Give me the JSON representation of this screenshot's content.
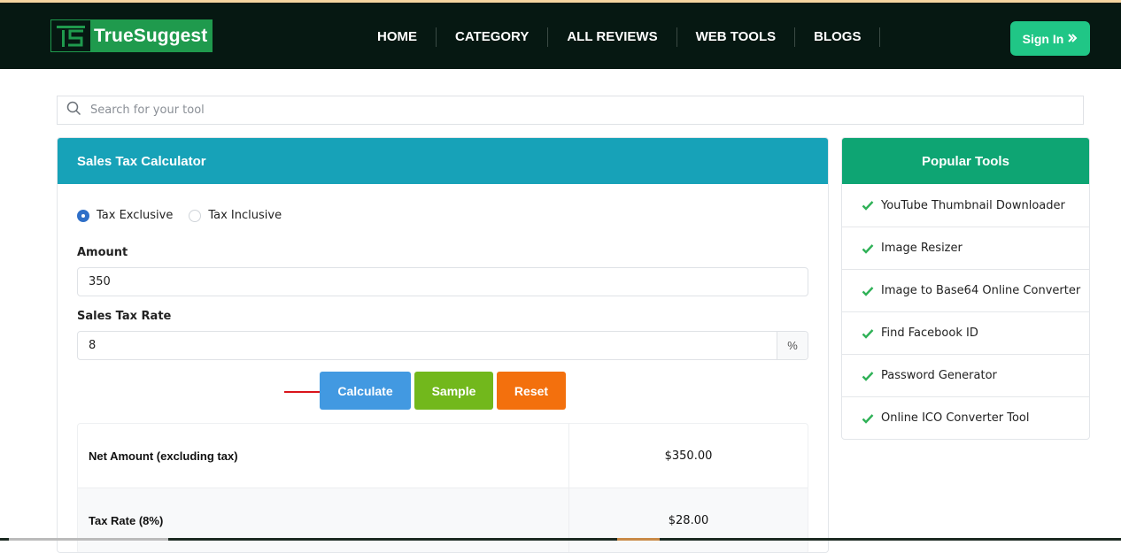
{
  "brand": {
    "name": "TrueSuggest",
    "mark": "TS",
    "accent": "#1f9a4d"
  },
  "nav": {
    "items": [
      {
        "label": "HOME"
      },
      {
        "label": "CATEGORY"
      },
      {
        "label": "ALL REVIEWS"
      },
      {
        "label": "WEB TOOLS"
      },
      {
        "label": "BLOGS"
      }
    ],
    "signin_label": "Sign In",
    "signin_icon": "double-chevron-right-icon"
  },
  "search": {
    "placeholder": "Search for your tool",
    "value": "",
    "icon": "search-icon"
  },
  "calculator": {
    "title": "Sales Tax Calculator",
    "header_color": "#17a2b8",
    "modes": [
      {
        "label": "Tax Exclusive",
        "selected": true
      },
      {
        "label": "Tax Inclusive",
        "selected": false
      }
    ],
    "amount": {
      "label": "Amount",
      "value": "350"
    },
    "rate": {
      "label": "Sales Tax Rate",
      "value": "8",
      "suffix": "%"
    },
    "buttons": {
      "calculate": "Calculate",
      "sample": "Sample",
      "reset": "Reset"
    },
    "results": [
      {
        "label": "Net Amount (excluding tax)",
        "value": "$350.00"
      },
      {
        "label": "Tax Rate (8%)",
        "value": "$28.00"
      }
    ]
  },
  "popular": {
    "title": "Popular Tools",
    "header_color": "#0ea573",
    "items": [
      {
        "label": "YouTube Thumbnail Downloader"
      },
      {
        "label": "Image Resizer"
      },
      {
        "label": "Image to Base64 Online Converter"
      },
      {
        "label": "Find Facebook ID"
      },
      {
        "label": "Password Generator"
      },
      {
        "label": "Online ICO Converter Tool"
      }
    ]
  }
}
